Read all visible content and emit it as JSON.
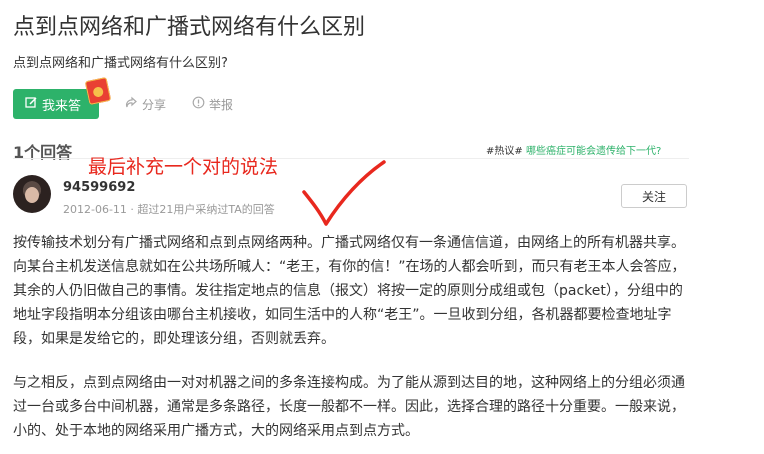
{
  "question": {
    "title": "点到点网络和广播式网络有什么区别",
    "description": "点到点网络和广播式网络有什么区别?"
  },
  "actions": {
    "answer_label": "我来答",
    "share_label": "分享",
    "report_label": "举报"
  },
  "answers_count": "1个回答",
  "hot_topic": {
    "tag": "#热议#",
    "link": "哪些癌症可能会遗传给下一代?"
  },
  "annotation": "最后补充一个对的说法",
  "answer": {
    "username": "94599692",
    "meta": "2012-06-11 · 超过21用户采纳过TA的回答",
    "follow_label": "关注",
    "paragraph1": "按传输技术划分有广播式网络和点到点网络两种。广播式网络仅有一条通信信道，由网络上的所有机器共享。向某台主机发送信息就如在公共场所喊人：“老王，有你的信！”在场的人都会听到，而只有老王本人会答应，其余的人仍旧做自己的事情。发往指定地点的信息（报文）将按一定的原则分成组或包（packet），分组中的地址字段指明本分组该由哪台主机接收，如同生活中的人称“老王”。一旦收到分组，各机器都要检查地址字段，如果是发给它的，即处理该分组，否则就丢弃。",
    "paragraph2": "与之相反，点到点网络由一对对机器之间的多条连接构成。为了能从源到达目的地，这种网络上的分组必须通过一台或多台中间机器，通常是多条路径，长度一般都不一样。因此，选择合理的路径十分重要。一般来说，小的、处于本地的网络采用广播方式，大的网络采用点到点方式。"
  },
  "colors": {
    "accent": "#2db26a",
    "annotation": "#e8281e"
  },
  "icons": [
    "edit-icon",
    "red-packet-icon",
    "share-icon",
    "report-icon",
    "avatar"
  ]
}
